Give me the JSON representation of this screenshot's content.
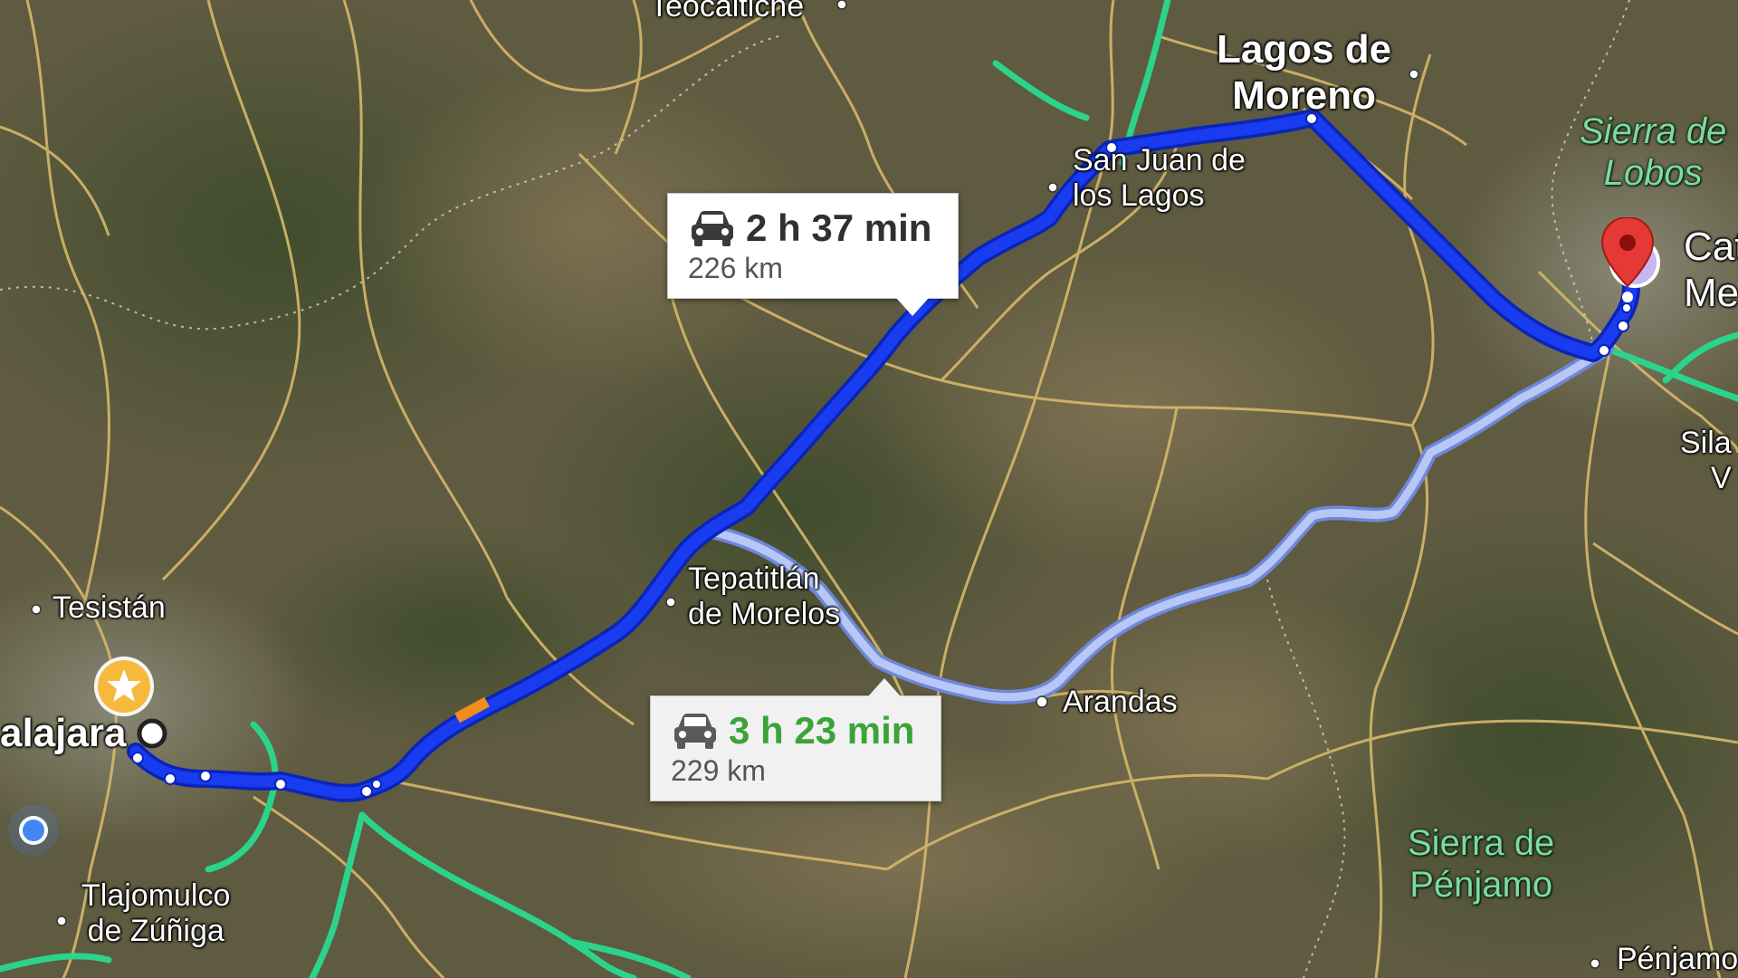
{
  "map": {
    "places": {
      "teocaltiche": "Teocaltiche",
      "lagos_de_moreno": "Lagos de\nMoreno",
      "san_juan_de_los_lagos": "San Juan de\nlos Lagos",
      "tepatitlan": "Tepatitlán\nde Morelos",
      "arandas": "Arandas",
      "tesistan": "Tesistán",
      "guadalajara": "alajara",
      "tlajomulco": "Tlajomulco\nde Zúñiga",
      "sierra_de_lobos": "Sierra de\nLobos",
      "sierra_de_penjamo": "Sierra de\nPénjamo",
      "cat_me": "Cat\nMe",
      "sila": "Sila\nV",
      "penjamo": "Pénjamo"
    },
    "colors": {
      "primary_route": "#1a3cf0",
      "primary_route_outline": "#0a24b8",
      "alt_route": "#a9bdf5",
      "alt_route_outline": "#6f86d9",
      "highway": "#2bd48a",
      "road": "#d7b86a",
      "traffic": "#f28c1b",
      "dest_pin": "#e53935",
      "origin_star": "#f6b93b",
      "my_location": "#4285f4"
    },
    "icons": {
      "destination": "map-pin-icon",
      "origin": "star-icon",
      "location": "my-location-dot-icon",
      "car": "car-icon"
    }
  },
  "routes": {
    "primary": {
      "time": "2 h 37 min",
      "distance": "226 km"
    },
    "alternate": {
      "time": "3 h 23 min",
      "distance": "229 km"
    }
  }
}
